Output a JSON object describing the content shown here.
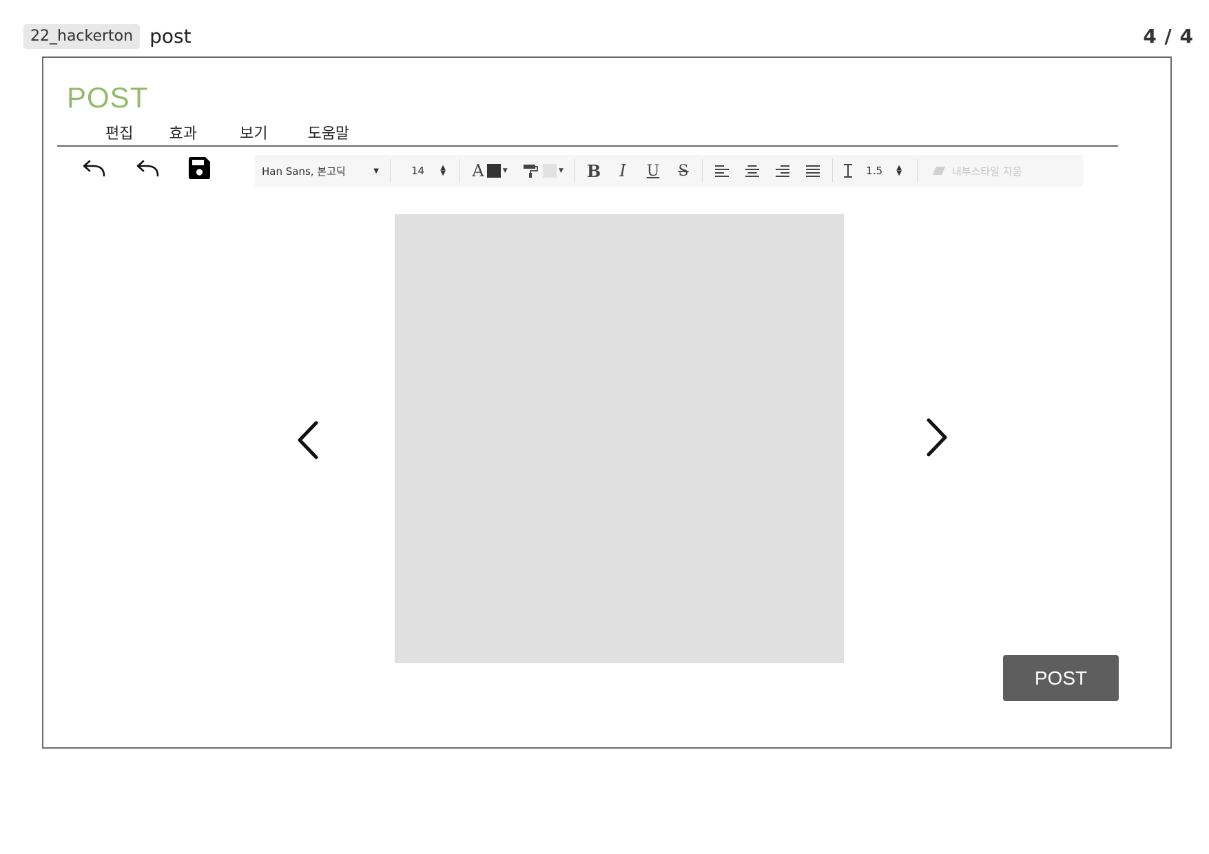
{
  "header": {
    "project": "22_hackerton",
    "page_name": "post",
    "page_counter": "4 / 4"
  },
  "app": {
    "title": "POST"
  },
  "menu": {
    "items": [
      {
        "label": "편집"
      },
      {
        "label": "효과"
      },
      {
        "label": "보기"
      },
      {
        "label": "도움말"
      }
    ]
  },
  "toolbar": {
    "undo_icon": "undo-icon",
    "redo_icon": "redo-icon",
    "save_icon": "floppy-disk-icon"
  },
  "format_bar": {
    "font_family": "Han Sans, 본고딕",
    "font_size": "14",
    "text_color": "#333333",
    "highlight_color": "#e2e2e2",
    "line_height": "1.5",
    "clear_style_label": "내부스타일 지움"
  },
  "carousel": {
    "image_placeholder_color": "#e0e0e0",
    "prev_icon": "chevron-left-icon",
    "next_icon": "chevron-right-icon"
  },
  "actions": {
    "post_label": "POST"
  },
  "colors": {
    "title_green": "#94bb6c",
    "button_gray": "#5e5e5e",
    "frame_border": "#6b6b6b"
  }
}
